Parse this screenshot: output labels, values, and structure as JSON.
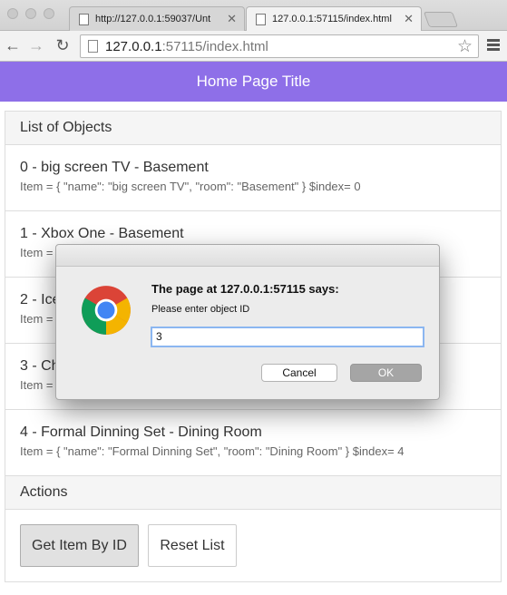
{
  "browser": {
    "tabs": [
      {
        "label": "http://127.0.0.1:59037/Unt"
      },
      {
        "label": "127.0.0.1:57115/index.html"
      }
    ],
    "url_host": "127.0.0.1",
    "url_rest": ":57115/index.html"
  },
  "header": {
    "title": "Home Page Title"
  },
  "list": {
    "heading": "List of Objects",
    "items": [
      {
        "title": "0 - big screen TV - Basement",
        "detail": "Item = { \"name\": \"big screen TV\", \"room\": \"Basement\" } $index= 0"
      },
      {
        "title": "1 - Xbox One - Basement",
        "detail": "Item ="
      },
      {
        "title": "2 - Ice",
        "detail": "Item ="
      },
      {
        "title": "3 - Ch",
        "detail": "Item ="
      },
      {
        "title": "4 - Formal Dinning Set - Dining Room",
        "detail": "Item = { \"name\": \"Formal Dinning Set\", \"room\": \"Dining Room\" } $index= 4"
      }
    ]
  },
  "actions": {
    "heading": "Actions",
    "get_item_label": "Get Item By ID",
    "reset_label": "Reset List"
  },
  "dialog": {
    "title": "The page at 127.0.0.1:57115 says:",
    "message": "Please enter object ID",
    "input_value": "3",
    "cancel_label": "Cancel",
    "ok_label": "OK"
  }
}
